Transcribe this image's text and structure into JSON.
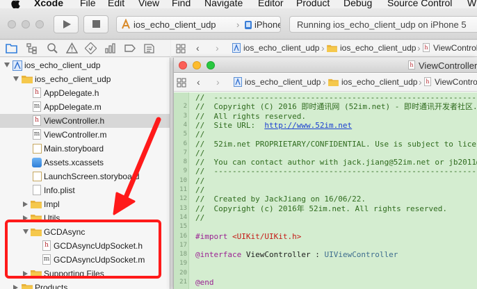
{
  "menubar": {
    "items": [
      "Xcode",
      "File",
      "Edit",
      "View",
      "Find",
      "Navigate",
      "Editor",
      "Product",
      "Debug",
      "Source Control",
      "W"
    ]
  },
  "toolbar": {
    "scheme": "ios_echo_client_udp",
    "scheme_sep": "›",
    "device": "iPhone 5",
    "status": "Running ios_echo_client_udp on iPhone 5"
  },
  "navigator": {
    "items": [
      {
        "label": "ios_echo_client_udp",
        "kind": "project"
      },
      {
        "label": "ios_echo_client_udp",
        "kind": "folder"
      },
      {
        "label": "AppDelegate.h",
        "kind": "h"
      },
      {
        "label": "AppDelegate.m",
        "kind": "m"
      },
      {
        "label": "ViewController.h",
        "kind": "h",
        "selected": true
      },
      {
        "label": "ViewController.m",
        "kind": "m"
      },
      {
        "label": "Main.storyboard",
        "kind": "storyboard"
      },
      {
        "label": "Assets.xcassets",
        "kind": "assets"
      },
      {
        "label": "LaunchScreen.storyboard",
        "kind": "storyboard"
      },
      {
        "label": "Info.plist",
        "kind": "plist"
      },
      {
        "label": "Impl",
        "kind": "folder"
      },
      {
        "label": "Utils",
        "kind": "folder"
      },
      {
        "label": "GCDAsync",
        "kind": "folder"
      },
      {
        "label": "GCDAsyncUdpSocket.h",
        "kind": "h"
      },
      {
        "label": "GCDAsyncUdpSocket.m",
        "kind": "m"
      },
      {
        "label": "Supporting Files",
        "kind": "folder"
      },
      {
        "label": "Products",
        "kind": "folder"
      }
    ]
  },
  "jumpbar": {
    "project": "ios_echo_client_udp",
    "group": "ios_echo_client_udp",
    "file": "ViewController.h",
    "file_short": "ViewControlle"
  },
  "editor": {
    "window_title": "ViewController",
    "file_badge": "h",
    "lines": [
      {
        "n": "",
        "t": "//  --------------------------------------------------------------------------",
        "c": "com"
      },
      {
        "n": "2",
        "t": "//  Copyright (C) 2016 即时通讯网 (52im.net) - 即时通讯开发者社区.",
        "c": "com"
      },
      {
        "n": "3",
        "t": "//  All rights reserved.",
        "c": "com"
      },
      {
        "n": "4",
        "t": "//  Site URL:  ",
        "c": "com",
        "link": "http://www.52im.net"
      },
      {
        "n": "5",
        "t": "//",
        "c": "com"
      },
      {
        "n": "6",
        "t": "//  52im.net PROPRIETARY/CONFIDENTIAL. Use is subject to licer",
        "c": "com"
      },
      {
        "n": "7",
        "t": "//",
        "c": "com"
      },
      {
        "n": "8",
        "t": "//  You can contact author with jack.jiang@52im.net or jb2011@",
        "c": "com"
      },
      {
        "n": "9",
        "t": "//  --------------------------------------------------------------------------",
        "c": "com"
      },
      {
        "n": "10",
        "t": "//",
        "c": "com"
      },
      {
        "n": "11",
        "t": "//",
        "c": "com"
      },
      {
        "n": "12",
        "t": "//  Created by JackJiang on 16/06/22.",
        "c": "com"
      },
      {
        "n": "13",
        "t": "//  Copyright (c) 2016年 52im.net. All rights reserved.",
        "c": "com"
      },
      {
        "n": "14",
        "t": "//",
        "c": "com"
      },
      {
        "n": "15",
        "t": "",
        "c": "plain"
      },
      {
        "n": "16",
        "t": "#import ",
        "c": "kw",
        "str": "<UIKit/UIKit.h>"
      },
      {
        "n": "17",
        "t": "",
        "c": "plain"
      },
      {
        "n": "18",
        "t": "@interface",
        "c": "kw",
        "rest": " ViewController : ",
        "type": "UIViewController"
      },
      {
        "n": "19",
        "t": "",
        "c": "plain"
      },
      {
        "n": "20",
        "t": "",
        "c": "plain"
      },
      {
        "n": "21",
        "t": "@end",
        "c": "kw"
      }
    ]
  },
  "colors": {
    "code_background": "#d4edd0",
    "comment": "#2f6b1e",
    "keyword": "#9b2393",
    "string": "#c41a16",
    "annotation_red": "#ff1a1a"
  }
}
